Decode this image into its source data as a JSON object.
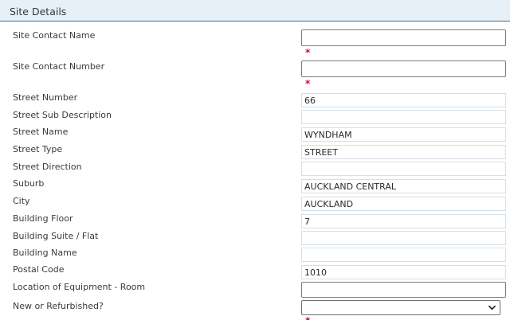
{
  "section": {
    "title": "Site Details"
  },
  "colors": {
    "header_bg": "#e8f0f7",
    "header_border": "#3b6c8e",
    "required_star": "#e0002a"
  },
  "required_marker": "*",
  "fields": {
    "site_contact_name": {
      "label": "Site Contact Name",
      "value": ""
    },
    "site_contact_number": {
      "label": "Site Contact Number",
      "value": ""
    },
    "street_number": {
      "label": "Street Number",
      "value": "66"
    },
    "street_sub_description": {
      "label": "Street Sub Description",
      "value": ""
    },
    "street_name": {
      "label": "Street Name",
      "value": "WYNDHAM"
    },
    "street_type": {
      "label": "Street Type",
      "value": "STREET"
    },
    "street_direction": {
      "label": "Street Direction",
      "value": ""
    },
    "suburb": {
      "label": "Suburb",
      "value": "AUCKLAND CENTRAL"
    },
    "city": {
      "label": "City",
      "value": "AUCKLAND"
    },
    "building_floor": {
      "label": "Building Floor",
      "value": "7"
    },
    "building_suite_flat": {
      "label": "Building Suite / Flat",
      "value": ""
    },
    "building_name": {
      "label": "Building Name",
      "value": ""
    },
    "postal_code": {
      "label": "Postal Code",
      "value": "1010"
    },
    "location_of_equipment": {
      "label": "Location of Equipment - Room",
      "value": ""
    },
    "new_or_refurbished": {
      "label": "New or Refurbished?",
      "selected": "",
      "icon": "chevron-down-icon"
    }
  }
}
